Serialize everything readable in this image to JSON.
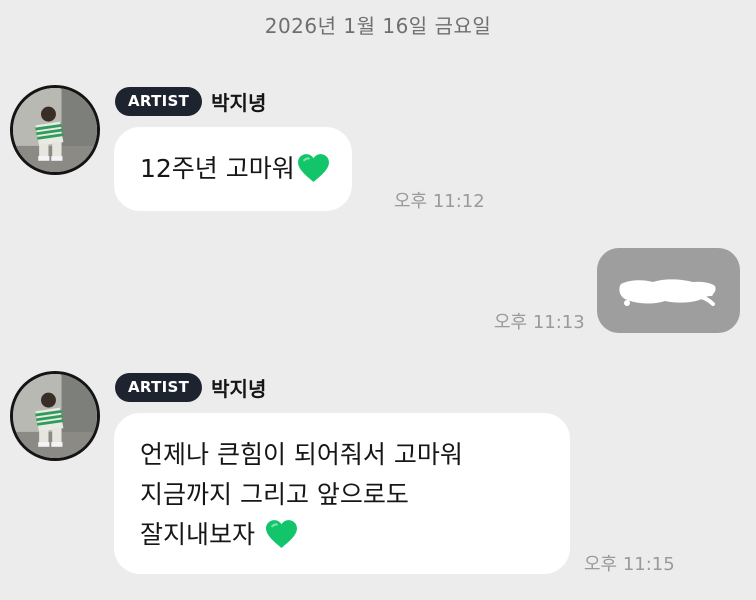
{
  "date_divider": "2026년 1월 16일 금요일",
  "messages": [
    {
      "badge": "ARTIST",
      "sender": "박지녕",
      "lines": [
        "12주년 고마워"
      ],
      "time": "오후 11:12"
    },
    {
      "time": "오후 11:13"
    },
    {
      "badge": "ARTIST",
      "sender": "박지녕",
      "lines": [
        "언제나 큰힘이 되어줘서 고마워",
        "지금까지 그리고 앞으로도",
        "잘지내보자 "
      ],
      "time": "오후 11:15"
    }
  ],
  "colors": {
    "background": "#ececec",
    "bubble": "#ffffff",
    "badge": "#1d2430",
    "heart": "#12c46a",
    "my_bubble": "#9e9e9e"
  },
  "icons": {
    "heart": "green-heart-icon",
    "avatar": "profile-photo"
  }
}
